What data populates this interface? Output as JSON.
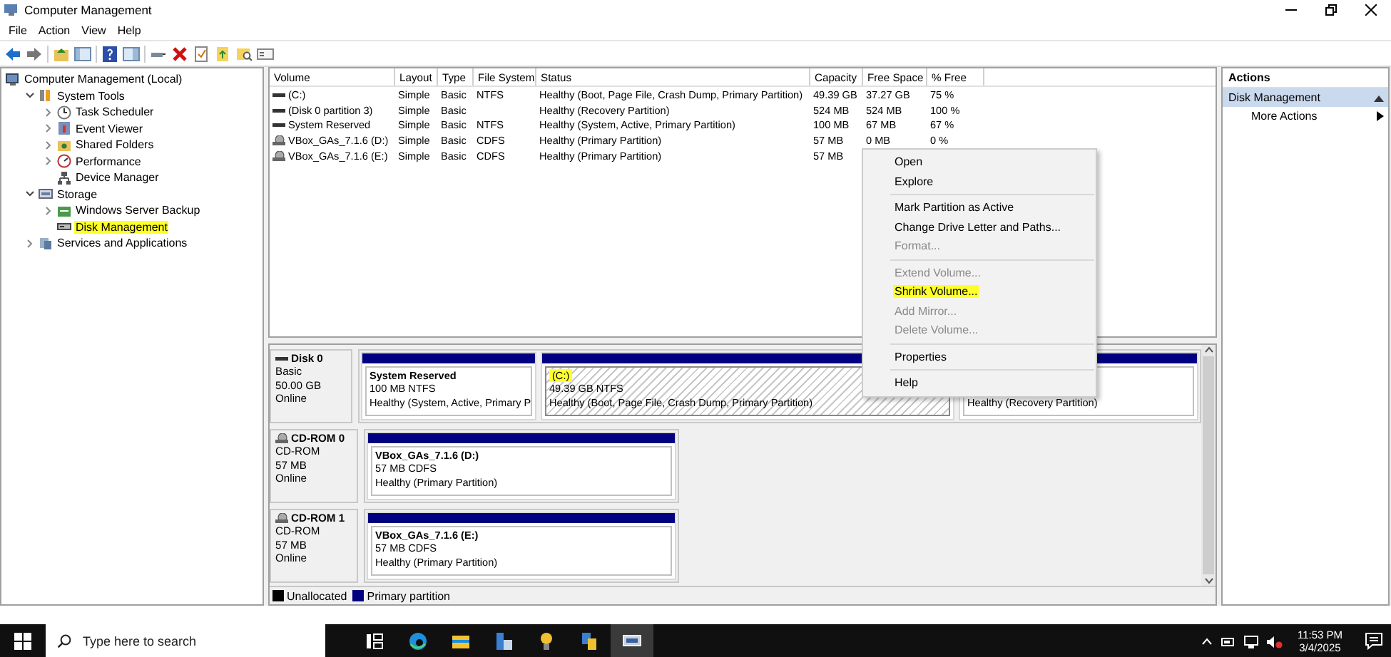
{
  "window": {
    "title": "Computer Management"
  },
  "menu": [
    "File",
    "Action",
    "View",
    "Help"
  ],
  "tree": [
    {
      "label": "Computer Management (Local)",
      "children": [
        {
          "label": "System Tools",
          "expanded": true,
          "children": [
            {
              "label": "Task Scheduler",
              "expanded": false
            },
            {
              "label": "Event Viewer",
              "expanded": false
            },
            {
              "label": "Shared Folders",
              "expanded": false
            },
            {
              "label": "Performance",
              "expanded": false
            },
            {
              "label": "Device Manager"
            }
          ]
        },
        {
          "label": "Storage",
          "expanded": true,
          "children": [
            {
              "label": "Windows Server Backup",
              "expanded": false
            },
            {
              "label": "Disk Management",
              "highlighted": true
            }
          ]
        },
        {
          "label": "Services and Applications",
          "expanded": false
        }
      ]
    }
  ],
  "volumes": {
    "columns": [
      "Volume",
      "Layout",
      "Type",
      "File System",
      "Status",
      "Capacity",
      "Free Space",
      "% Free"
    ],
    "rows": [
      {
        "kind": "disk",
        "cells": [
          "(C:)",
          "Simple",
          "Basic",
          "NTFS",
          "Healthy (Boot, Page File, Crash Dump, Primary Partition)",
          "49.39 GB",
          "37.27 GB",
          "75 %"
        ]
      },
      {
        "kind": "disk",
        "cells": [
          "(Disk 0 partition 3)",
          "Simple",
          "Basic",
          "",
          "Healthy (Recovery Partition)",
          "524 MB",
          "524 MB",
          "100 %"
        ]
      },
      {
        "kind": "disk",
        "cells": [
          "System Reserved",
          "Simple",
          "Basic",
          "NTFS",
          "Healthy (System, Active, Primary Partition)",
          "100 MB",
          "67 MB",
          "67 %"
        ]
      },
      {
        "kind": "cdrom",
        "cells": [
          "VBox_GAs_7.1.6 (D:)",
          "Simple",
          "Basic",
          "CDFS",
          "Healthy (Primary Partition)",
          "57 MB",
          "0 MB",
          "0 %"
        ]
      },
      {
        "kind": "cdrom",
        "cells": [
          "VBox_GAs_7.1.6 (E:)",
          "Simple",
          "Basic",
          "CDFS",
          "Healthy (Primary Partition)",
          "57 MB"
        ]
      }
    ]
  },
  "disks": [
    {
      "kind": "disk",
      "name": "Disk 0",
      "type": "Basic",
      "size": "50.00 GB",
      "status": "Online",
      "partitions": [
        {
          "title": "System Reserved",
          "size": "100 MB NTFS",
          "status": "Healthy (System, Active, Primary P",
          "selected": false
        },
        {
          "title": "(C:)",
          "size": "49.39 GB NTFS",
          "status": "Healthy (Boot, Page File, Crash Dump, Primary Partition)",
          "selected": true,
          "highlighted": true
        },
        {
          "status": "Healthy (Recovery Partition)",
          "selected": false
        }
      ]
    },
    {
      "kind": "cdrom",
      "name": "CD-ROM 0",
      "type": "CD-ROM",
      "size": "57 MB",
      "status": "Online",
      "partitions": [
        {
          "title": "VBox_GAs_7.1.6  (D:)",
          "size": "57 MB CDFS",
          "status": "Healthy (Primary Partition)",
          "selected": false
        }
      ]
    },
    {
      "kind": "cdrom",
      "name": "CD-ROM 1",
      "type": "CD-ROM",
      "size": "57 MB",
      "status": "Online",
      "partitions": [
        {
          "title": "VBox_GAs_7.1.6  (E:)",
          "size": "57 MB CDFS",
          "status": "Healthy (Primary Partition)",
          "selected": false
        }
      ]
    }
  ],
  "legend": [
    {
      "label": "Unallocated",
      "color": "#000000"
    },
    {
      "label": "Primary partition",
      "color": "#000080"
    }
  ],
  "context_menu": [
    {
      "kind": "item",
      "label": "Open",
      "disabled": false
    },
    {
      "kind": "item",
      "label": "Explore",
      "disabled": false
    },
    {
      "kind": "separator"
    },
    {
      "kind": "item",
      "label": "Mark Partition as Active",
      "disabled": false
    },
    {
      "kind": "item",
      "label": "Change Drive Letter and Paths...",
      "disabled": false
    },
    {
      "kind": "item",
      "label": "Format...",
      "disabled": true
    },
    {
      "kind": "separator"
    },
    {
      "kind": "item",
      "label": "Extend Volume...",
      "disabled": true
    },
    {
      "kind": "item",
      "label": "Shrink Volume...",
      "disabled": false,
      "highlighted": true
    },
    {
      "kind": "item",
      "label": "Add Mirror...",
      "disabled": true
    },
    {
      "kind": "item",
      "label": "Delete Volume...",
      "disabled": true
    },
    {
      "kind": "separator"
    },
    {
      "kind": "item",
      "label": "Properties",
      "disabled": false
    },
    {
      "kind": "separator"
    },
    {
      "kind": "item",
      "label": "Help",
      "disabled": false
    }
  ],
  "actions": {
    "title": "Actions",
    "section": {
      "label": "Disk Management",
      "selected": true
    },
    "items": [
      {
        "label": "More Actions"
      }
    ]
  },
  "taskbar": {
    "search": {
      "placeholder": "Type here to search"
    },
    "time": "11:53 PM",
    "date": "3/4/2025"
  }
}
